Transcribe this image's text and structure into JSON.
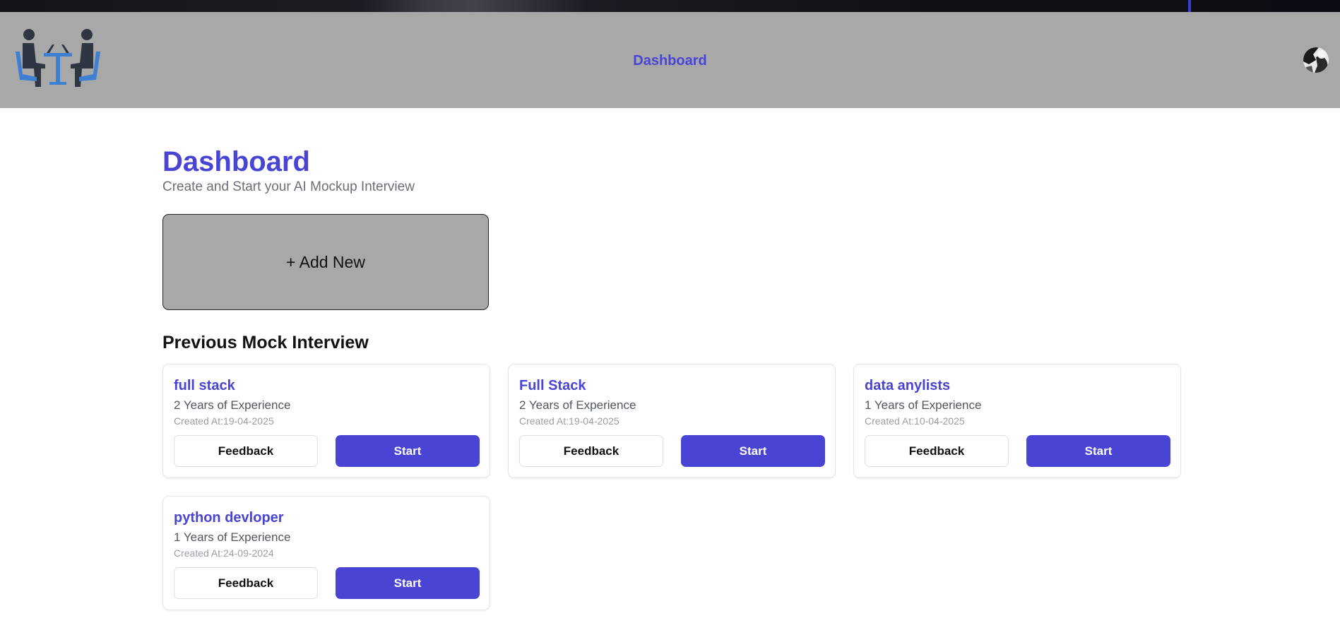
{
  "colors": {
    "accent": "#4a44d4",
    "header_bg": "#a8a8a8",
    "logo_blue": "#3f7fd2",
    "logo_dark": "#2f3642"
  },
  "header": {
    "logo_icon": "interview-people-at-table-icon",
    "nav_dashboard": "Dashboard",
    "avatar_icon": "user-avatar"
  },
  "main": {
    "title": "Dashboard",
    "subtitle": "Create and Start your AI Mockup Interview",
    "add_new_label": "+ Add New",
    "previous_title": "Previous Mock Interview",
    "interviews": [
      {
        "role": "full stack",
        "experience": "2 Years of Experience",
        "created_label": "Created At:",
        "created_date": "19-04-2025",
        "feedback_label": "Feedback",
        "start_label": "Start"
      },
      {
        "role": "Full Stack",
        "experience": "2 Years of Experience",
        "created_label": "Created At:",
        "created_date": "19-04-2025",
        "feedback_label": "Feedback",
        "start_label": "Start"
      },
      {
        "role": "data anylists",
        "experience": "1 Years of Experience",
        "created_label": "Created At:",
        "created_date": "10-04-2025",
        "feedback_label": "Feedback",
        "start_label": "Start"
      },
      {
        "role": "python devloper",
        "experience": "1 Years of Experience",
        "created_label": "Created At:",
        "created_date": "24-09-2024",
        "feedback_label": "Feedback",
        "start_label": "Start"
      }
    ]
  }
}
